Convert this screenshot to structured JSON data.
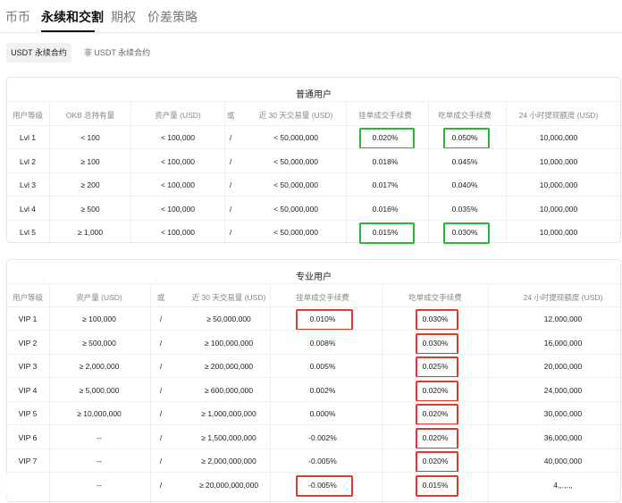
{
  "tabs": [
    "币币",
    "永续和交割",
    "期权",
    "价差策略"
  ],
  "segments": [
    "USDT 永续合约",
    "非 USDT 永续合约"
  ],
  "regular": {
    "title": "普通用户",
    "headers": [
      "用户等级",
      "OKB 总持有量",
      "资产量 (USD)",
      "或",
      "近 30 天交易量 (USD)",
      "挂单成交手续费",
      "吃单成交手续费",
      "24 小时提现额度 (USD)"
    ],
    "rows": [
      [
        "Lvl 1",
        "< 100",
        "< 100,000",
        "/",
        "< 50,000,000",
        "0.020%",
        "0.050%",
        "10,000,000"
      ],
      [
        "Lvl 2",
        "≥ 100",
        "< 100,000",
        "/",
        "< 50,000,000",
        "0.018%",
        "0.045%",
        "10,000,000"
      ],
      [
        "Lvl 3",
        "≥ 200",
        "< 100,000",
        "/",
        "< 50,000,000",
        "0.017%",
        "0.040%",
        "10,000,000"
      ],
      [
        "Lvl 4",
        "≥ 500",
        "< 100,000",
        "/",
        "< 50,000,000",
        "0.016%",
        "0.035%",
        "10,000,000"
      ],
      [
        "Lvl 5",
        "≥ 1,000",
        "< 100,000",
        "/",
        "< 50,000,000",
        "0.015%",
        "0.030%",
        "10,000,000"
      ]
    ]
  },
  "pro": {
    "title": "专业用户",
    "headers": [
      "用户等级",
      "资产量 (USD)",
      "或",
      "近 30 天交易量 (USD)",
      "挂单成交手续费",
      "吃单成交手续费",
      "24 小时提现额度 (USD)"
    ],
    "rows": [
      [
        "VIP 1",
        "≥ 100,000",
        "/",
        "≥ 50,000,000",
        "0.010%",
        "0.030%",
        "12,000,000"
      ],
      [
        "VIP 2",
        "≥ 500,000",
        "/",
        "≥ 100,000,000",
        "0.008%",
        "0.030%",
        "16,000,000"
      ],
      [
        "VIP 3",
        "≥ 2,000,000",
        "/",
        "≥ 200,000,000",
        "0.005%",
        "0.025%",
        "20,000,000"
      ],
      [
        "VIP 4",
        "≥ 5,000,000",
        "/",
        "≥ 600,000,000",
        "0.002%",
        "0.020%",
        "24,000,000"
      ],
      [
        "VIP 5",
        "≥ 10,000,000",
        "/",
        "≥ 1,000,000,000",
        "0.000%",
        "0.020%",
        "30,000,000"
      ],
      [
        "VIP 6",
        "--",
        "/",
        "≥ 1,500,000,000",
        "-0.002%",
        "0.020%",
        "36,000,000"
      ],
      [
        "VIP 7",
        "--",
        "/",
        "≥ 2,000,000,000",
        "-0.005%",
        "0.020%",
        "40,000,000"
      ],
      [
        "",
        "--",
        "/",
        "≥ 20,000,000,000",
        "-0.005%",
        "0.015%",
        "4,,.,.,,"
      ]
    ]
  },
  "highlight_colors": {
    "green": "#2db53a",
    "red": "#e03a2f"
  }
}
